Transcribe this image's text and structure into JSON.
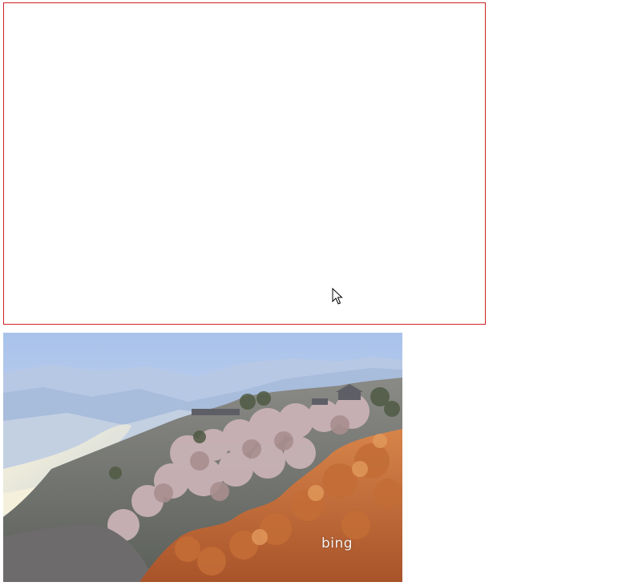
{
  "photo": {
    "watermark": "bing"
  }
}
